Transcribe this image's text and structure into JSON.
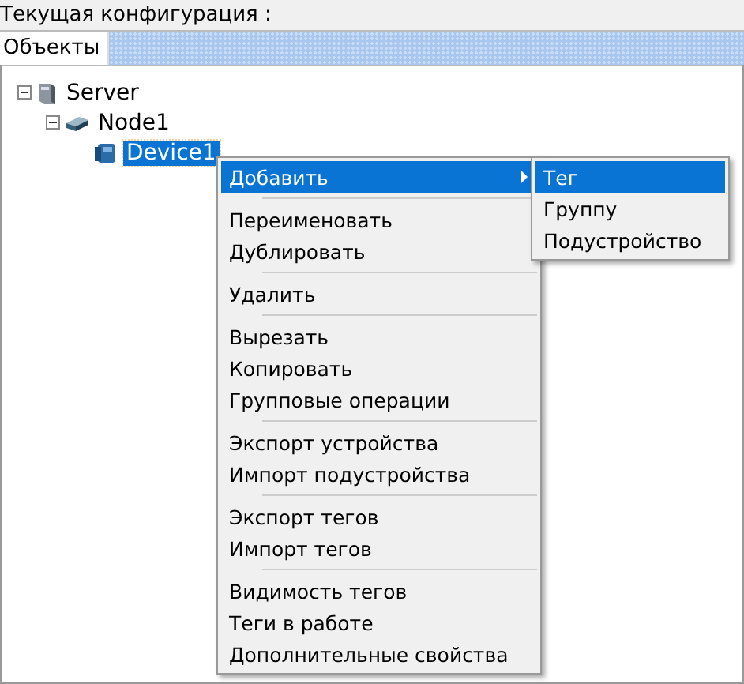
{
  "header": {
    "title": "Текущая конфигурация :"
  },
  "tabs": [
    {
      "label": "Объекты",
      "selected": true
    }
  ],
  "tree": [
    {
      "label": "Server",
      "kind": "server",
      "expanded": true,
      "selected": false,
      "children": [
        {
          "label": "Node1",
          "kind": "node",
          "expanded": true,
          "selected": false,
          "children": [
            {
              "label": "Device1",
              "kind": "device",
              "selected": true
            }
          ]
        }
      ]
    }
  ],
  "context_menu": {
    "groups": [
      [
        {
          "label": "Добавить",
          "selected": true,
          "submenu": true
        }
      ],
      [
        {
          "label": "Переименовать",
          "selected": false
        },
        {
          "label": "Дублировать",
          "selected": false
        }
      ],
      [
        {
          "label": "Удалить",
          "selected": false
        }
      ],
      [
        {
          "label": "Вырезать",
          "selected": false
        },
        {
          "label": "Копировать",
          "selected": false
        },
        {
          "label": "Групповые операции",
          "selected": false
        }
      ],
      [
        {
          "label": "Экспорт устройства",
          "selected": false
        },
        {
          "label": "Импорт подустройства",
          "selected": false
        }
      ],
      [
        {
          "label": "Экспорт  тегов",
          "selected": false
        },
        {
          "label": "Импорт тегов",
          "selected": false
        }
      ],
      [
        {
          "label": "Видимость тегов",
          "selected": false
        },
        {
          "label": "Теги в работе",
          "selected": false
        },
        {
          "label": "Дополнительные свойства",
          "selected": false
        }
      ]
    ]
  },
  "submenu": {
    "items": [
      {
        "label": "Тег",
        "selected": true
      },
      {
        "label": "Группу",
        "selected": false
      },
      {
        "label": "Подустройство",
        "selected": false
      }
    ]
  }
}
